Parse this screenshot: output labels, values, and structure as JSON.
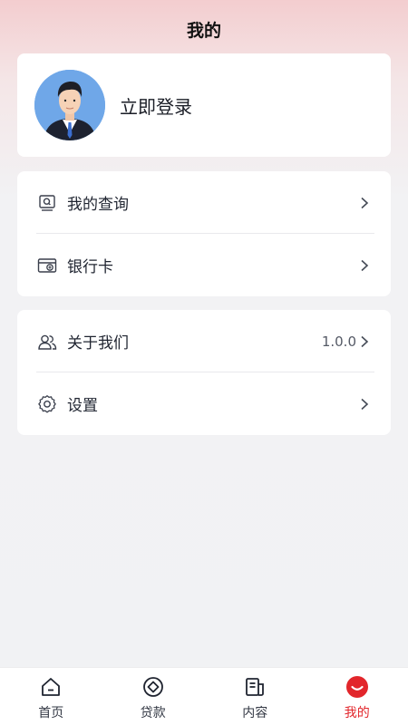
{
  "header": {
    "title": "我的"
  },
  "profile": {
    "login_label": "立即登录"
  },
  "menu_group_1": {
    "items": [
      {
        "label": "我的查询",
        "icon": "search-doc-icon"
      },
      {
        "label": "银行卡",
        "icon": "bank-card-icon"
      }
    ]
  },
  "menu_group_2": {
    "items": [
      {
        "label": "关于我们",
        "value": "1.0.0",
        "icon": "people-icon"
      },
      {
        "label": "设置",
        "icon": "gear-icon"
      }
    ]
  },
  "tabbar": {
    "tabs": [
      {
        "label": "首页",
        "icon": "home-icon"
      },
      {
        "label": "贷款",
        "icon": "loan-icon"
      },
      {
        "label": "内容",
        "icon": "content-icon"
      },
      {
        "label": "我的",
        "icon": "profile-icon",
        "active": true
      }
    ]
  },
  "colors": {
    "accent": "#e2262b",
    "avatar_bg": "#6fa7e8"
  }
}
